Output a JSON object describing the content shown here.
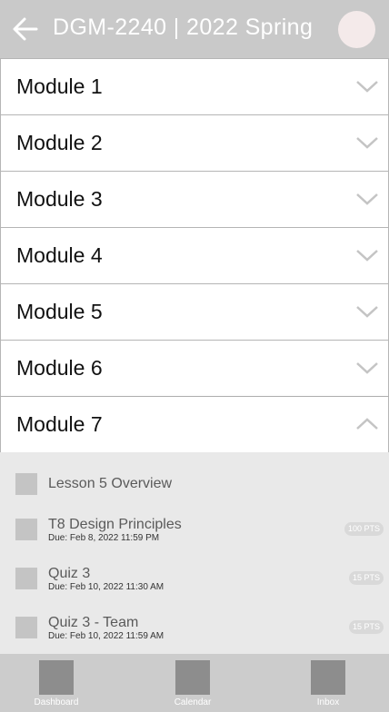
{
  "header": {
    "title": "DGM-2240 | 2022 Spring",
    "back_icon": "arrow-left-icon"
  },
  "modules": [
    {
      "label": "Module 1",
      "state": "collapsed"
    },
    {
      "label": "Module 2",
      "state": "collapsed"
    },
    {
      "label": "Module 3",
      "state": "collapsed"
    },
    {
      "label": "Module 4",
      "state": "collapsed"
    },
    {
      "label": "Module 5",
      "state": "collapsed"
    },
    {
      "label": "Module 6",
      "state": "collapsed"
    },
    {
      "label": "Module 7",
      "state": "expanded"
    }
  ],
  "module_items": [
    {
      "title": "Lesson 5 Overview",
      "due": "",
      "points": ""
    },
    {
      "title": "T8 Design Principles",
      "due": "Due: Feb 8, 2022 11:59 PM",
      "points": "100 PTS"
    },
    {
      "title": "Quiz 3",
      "due": "Due: Feb 10, 2022 11:30 AM",
      "points": "15 PTS"
    },
    {
      "title": "Quiz 3 - Team",
      "due": "Due: Feb 10, 2022 11:59 AM",
      "points": "15 PTS"
    }
  ],
  "bottom_nav": [
    {
      "label": "Dashboard"
    },
    {
      "label": "Calendar"
    },
    {
      "label": "Inbox"
    }
  ],
  "colors": {
    "header_bg": "#c9c9c9",
    "avatar": "#f4eaea",
    "nav_bg": "#cccccc",
    "chevron": "#c4c4c4"
  }
}
